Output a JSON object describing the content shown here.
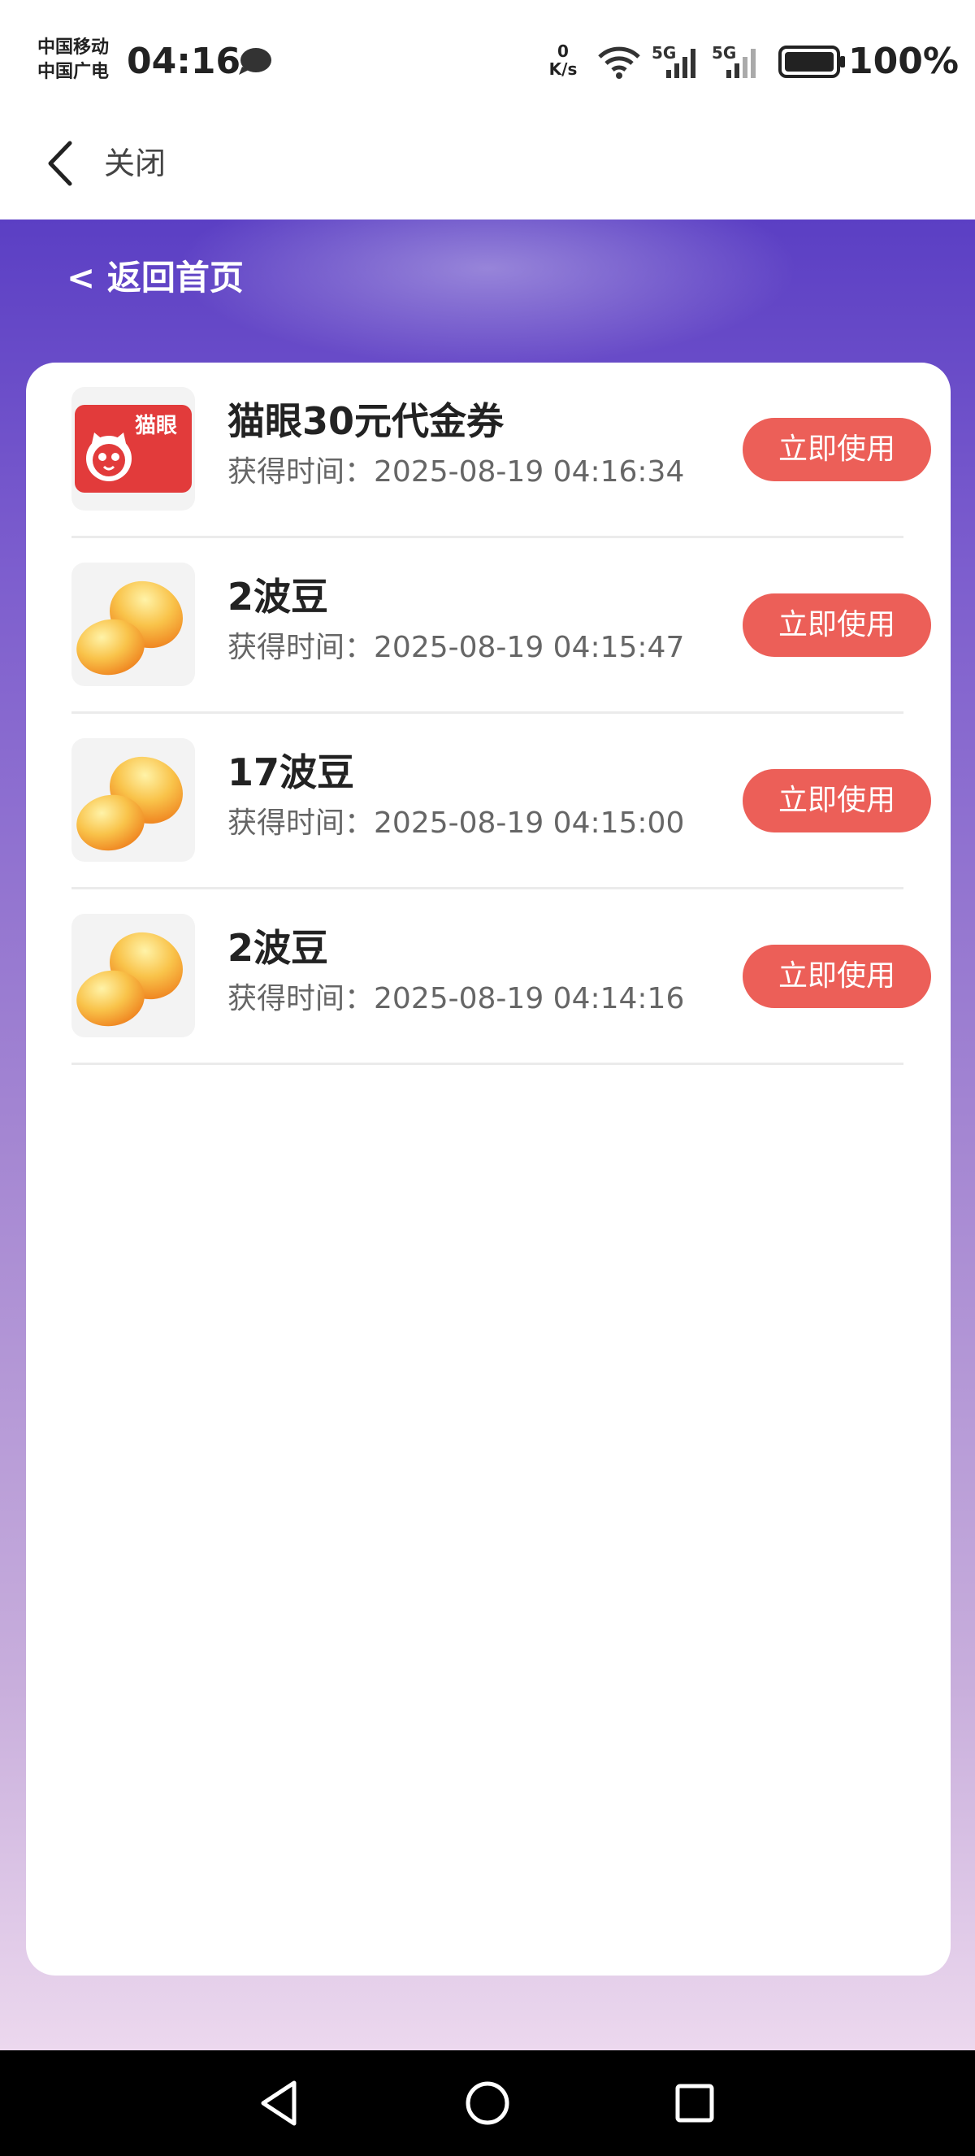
{
  "status_bar": {
    "carrier_line1": "中国移动",
    "carrier_line2": "中国广电",
    "time": "04:16",
    "net_speed_value": "0",
    "net_speed_unit": "K/s",
    "signal1_label": "5G",
    "signal2_label": "5G",
    "battery": "100%"
  },
  "title_bar": {
    "close_label": "关闭"
  },
  "header": {
    "back_home_label": "< 返回首页"
  },
  "rewards": {
    "button_label": "立即使用",
    "time_prefix": "获得时间：",
    "items": [
      {
        "title": "猫眼30元代金券",
        "time": "2025-08-19 04:16:34",
        "icon": "maoyan-logo-icon",
        "logo_text": "猫眼"
      },
      {
        "title": "2波豆",
        "time": "2025-08-19 04:15:47",
        "icon": "bean-icon"
      },
      {
        "title": "17波豆",
        "time": "2025-08-19 04:15:00",
        "icon": "bean-icon"
      },
      {
        "title": "2波豆",
        "time": "2025-08-19 04:14:16",
        "icon": "bean-icon"
      }
    ]
  },
  "colors": {
    "accent": "#ec5f58",
    "purple_top": "#5b3fc4",
    "purple_bottom": "#ecd8ee"
  }
}
